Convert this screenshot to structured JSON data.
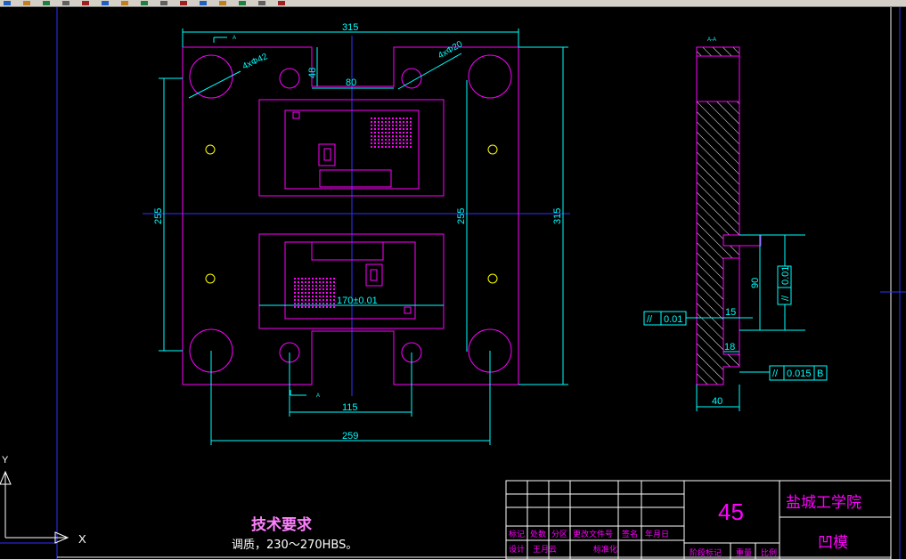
{
  "colors": {
    "outline": "#ff00ff",
    "dimension": "#00ffff",
    "centerline": "#3030ff",
    "feature": "#ffff00",
    "background": "#000000"
  },
  "toolbar": {
    "icons": [
      "new-icon",
      "open-icon",
      "save-icon",
      "print-icon",
      "preview-icon",
      "cut-icon",
      "copy-icon",
      "paste-icon",
      "match-icon",
      "undo-icon",
      "redo-icon",
      "pan-icon",
      "zoom-icon",
      "properties-icon",
      "layer-icon"
    ]
  },
  "drawing": {
    "dims": {
      "overall_width": "315",
      "overall_height": "315",
      "hole_large": "4xΦ42",
      "hole_small": "4xΦ20",
      "offset_48": "48",
      "slot_80": "80",
      "height_255_left": "255",
      "height_255_inner": "255",
      "tol_170": "170±0.01",
      "bottom_115": "115",
      "bottom_259": "259",
      "section_90": "90",
      "section_15": "15",
      "section_18": "18",
      "section_40": "40"
    },
    "section_marks": {
      "top": "A",
      "bottom": "A",
      "side": "A-A"
    },
    "tolerances": {
      "parallel_left": {
        "symbol": "//",
        "value": "0.01"
      },
      "parallel_right": {
        "symbol": "//",
        "value": "0.01"
      },
      "parallel_bottom": {
        "symbol": "//",
        "value": "0.015",
        "datum": "B"
      }
    }
  },
  "tech_req": {
    "title": "技术要求",
    "text": "调质，230～270HBS。"
  },
  "title_block": {
    "headers": [
      "标记",
      "处数",
      "分区",
      "更改文件号",
      "签名",
      "年月日"
    ],
    "row_design": [
      "设计",
      "王月云",
      "标准化"
    ],
    "stage_labels": [
      "阶段标记",
      "重量",
      "比例"
    ],
    "material": "45",
    "school": "盐城工学院",
    "part_name": "凹模"
  },
  "ucs": {
    "x": "X",
    "y": "Y"
  }
}
